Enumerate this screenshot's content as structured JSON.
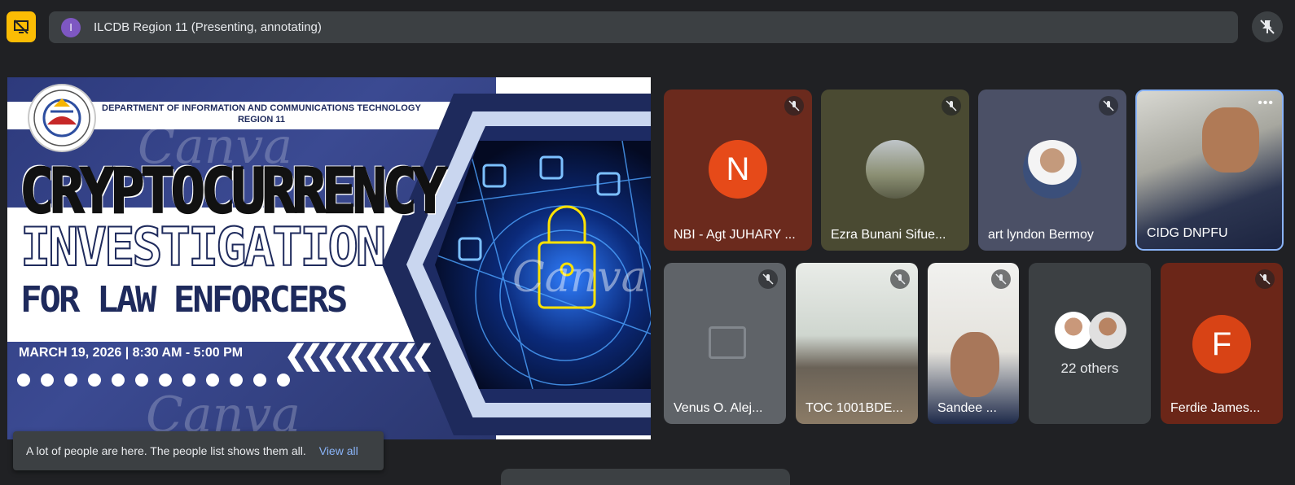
{
  "presentation_bar": {
    "presenter_initial": "I",
    "title": "ILCDB Region 11 (Presenting, annotating)"
  },
  "slide": {
    "dept_line1": "DEPARTMENT OF INFORMATION AND COMMUNICATIONS TECHNOLOGY",
    "dept_line2": "REGION 11",
    "title_line1": "CRYPTOCURRENCY",
    "title_line2": "INVESTIGATION",
    "title_line3": "FOR LAW ENFORCERS",
    "date": "MARCH 19, 2026 | 8:30 AM - 5:00 PM",
    "watermark": "Canva"
  },
  "participants": [
    {
      "name": "NBI - Agt JUHARY ...",
      "initial": "N",
      "avatar_color": "#e64a19",
      "muted": true
    },
    {
      "name": "Ezra Bunani Sifue...",
      "muted": true
    },
    {
      "name": "art lyndon Bermoy",
      "muted": true
    },
    {
      "name": "CIDG DNPFU",
      "muted": false
    },
    {
      "name": "Venus O. Alej...",
      "muted": true
    },
    {
      "name": "TOC 1001BDE...",
      "muted": true
    },
    {
      "name": "Sandee ...",
      "muted": true
    },
    {
      "name": "22 others"
    },
    {
      "name": "Ferdie James...",
      "initial": "F",
      "avatar_color": "#d84315",
      "muted": true
    }
  ],
  "toast": {
    "message": "A lot of people are here. The people list shows them all.",
    "action": "View all"
  },
  "colors": {
    "background": "#202124",
    "present_button": "#fbbc04",
    "link": "#8ab4f8",
    "active_speaker_border": "#8ab4f8"
  }
}
